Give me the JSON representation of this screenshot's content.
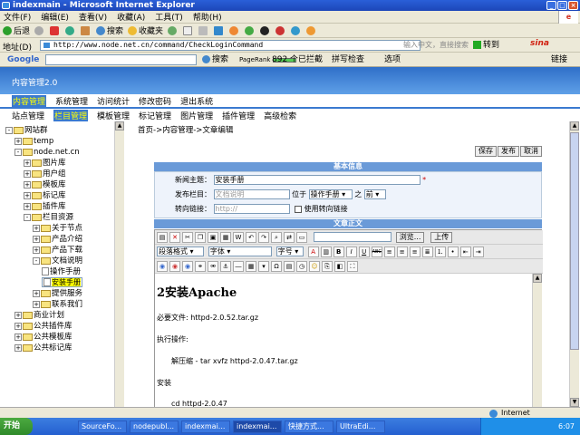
{
  "window": {
    "title": "indexmain - Microsoft Internet Explorer",
    "min": "_",
    "max": "□",
    "close": "×",
    "winlogo": "e"
  },
  "menu": [
    "文件(F)",
    "编辑(E)",
    "查看(V)",
    "收藏(A)",
    "工具(T)",
    "帮助(H)"
  ],
  "toolbar": {
    "back": "后退",
    "search": "搜索",
    "favorites": "收藏夹"
  },
  "address": {
    "label": "地址(D)",
    "url": "http://www.node.net.cn/command/CheckLoginCommand",
    "search_hint": "输入中文，直接搜索",
    "go": "转到",
    "sina": "sina"
  },
  "google": {
    "logo": "Google",
    "search": "搜索",
    "pagerank": "PageRank",
    "blocked": "892 个已拦截",
    "spell": "拼写检查",
    "options": "选项",
    "links": "链接"
  },
  "app": {
    "header": "内容管理2.0"
  },
  "nav1": [
    {
      "label": "内容管理",
      "active": true
    },
    {
      "label": "系统管理"
    },
    {
      "label": "访问统计"
    },
    {
      "label": "修改密码"
    },
    {
      "label": "退出系统"
    }
  ],
  "nav2": [
    {
      "label": "站点管理"
    },
    {
      "label": "栏目管理",
      "active": true
    },
    {
      "label": "模板管理"
    },
    {
      "label": "标记管理"
    },
    {
      "label": "图片管理"
    },
    {
      "label": "插件管理"
    },
    {
      "label": "高级检索"
    }
  ],
  "tree": [
    {
      "label": "网站群",
      "level": 0,
      "toggle": "-"
    },
    {
      "label": "temp",
      "level": 1,
      "toggle": "+"
    },
    {
      "label": "node.net.cn",
      "level": 1,
      "toggle": "-"
    },
    {
      "label": "图片库",
      "level": 2,
      "toggle": "+"
    },
    {
      "label": "用户组",
      "level": 2,
      "toggle": "+"
    },
    {
      "label": "模板库",
      "level": 2,
      "toggle": "+"
    },
    {
      "label": "标记库",
      "level": 2,
      "toggle": "+"
    },
    {
      "label": "插件库",
      "level": 2,
      "toggle": "+"
    },
    {
      "label": "栏目资源",
      "level": 2,
      "toggle": "-"
    },
    {
      "label": "关于节点",
      "level": 3,
      "toggle": "+"
    },
    {
      "label": "产品介绍",
      "level": 3,
      "toggle": "+"
    },
    {
      "label": "产品下载",
      "level": 3,
      "toggle": "+"
    },
    {
      "label": "文档说明",
      "level": 3,
      "toggle": "-"
    },
    {
      "label": "操作手册",
      "level": 4,
      "doc": true
    },
    {
      "label": "安装手册",
      "level": 4,
      "doc": true,
      "selected": true
    },
    {
      "label": "提供服务",
      "level": 3,
      "toggle": "+"
    },
    {
      "label": "联系我们",
      "level": 3,
      "toggle": "+"
    },
    {
      "label": "商业计划",
      "level": 1,
      "toggle": "+"
    },
    {
      "label": "公共插件库",
      "level": 1,
      "toggle": "+"
    },
    {
      "label": "公共模板库",
      "level": 1,
      "toggle": "+"
    },
    {
      "label": "公共标记库",
      "level": 1,
      "toggle": "+"
    }
  ],
  "content": {
    "breadcrumb": "首页->内容管理->文章编辑",
    "buttons": {
      "save": "保存",
      "publish": "发布",
      "cancel": "取消"
    },
    "basic_info": "基本信息",
    "form": {
      "title_label": "新闻主题：",
      "title_value": "安装手册",
      "required": "*",
      "column_label": "发布栏目：",
      "column_placeholder": "文档说明",
      "position_label": "位于",
      "position_value": "操作手册",
      "of_label": "之",
      "order_value": "前",
      "link_label": "转向链接：",
      "link_placeholder": "http://",
      "use_link_label": "使用转向链接"
    },
    "body_title": "文章正文",
    "editor": {
      "browse": "浏览...",
      "upload": "上传",
      "paragraph": "段落格式",
      "font": "字体",
      "size": "字号",
      "bold": "B",
      "italic": "I",
      "underline": "U",
      "strike": "ABC"
    },
    "doc": {
      "heading": "2安装Apache",
      "lines": [
        "必要文件: httpd-2.0.52.tar.gz",
        "执行操作:",
        "解压缩 - tar xvfz httpd-2.0.47.tar.gz",
        "安装",
        "cd httpd-2.0.47"
      ]
    }
  },
  "status": {
    "zone": "Internet"
  },
  "taskbar": {
    "start": "开始",
    "tasks": [
      {
        "label": "SourceFo..."
      },
      {
        "label": "nodepubl..."
      },
      {
        "label": "indexmai..."
      },
      {
        "label": "indexmai...",
        "active": true
      },
      {
        "label": "快捷方式..."
      },
      {
        "label": "UltraEdi..."
      }
    ],
    "clock": "6:07"
  },
  "colors": {
    "nav_active": "#3a7ad0",
    "header": "#2f6fc8",
    "selected": "#ffff00"
  }
}
